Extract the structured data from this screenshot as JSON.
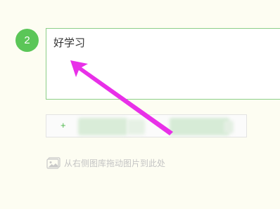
{
  "step": {
    "number": "2"
  },
  "editor": {
    "value": "好学习"
  },
  "add_bar": {
    "plus_label": "+"
  },
  "drag_hint": {
    "icon": "image-icon",
    "text": "从右侧图库拖动图片到此处"
  },
  "colors": {
    "accent_green": "#5bc658",
    "editor_border": "#8ccf87",
    "annotation_magenta": "#e830e8",
    "background": "#fdfdf2"
  }
}
